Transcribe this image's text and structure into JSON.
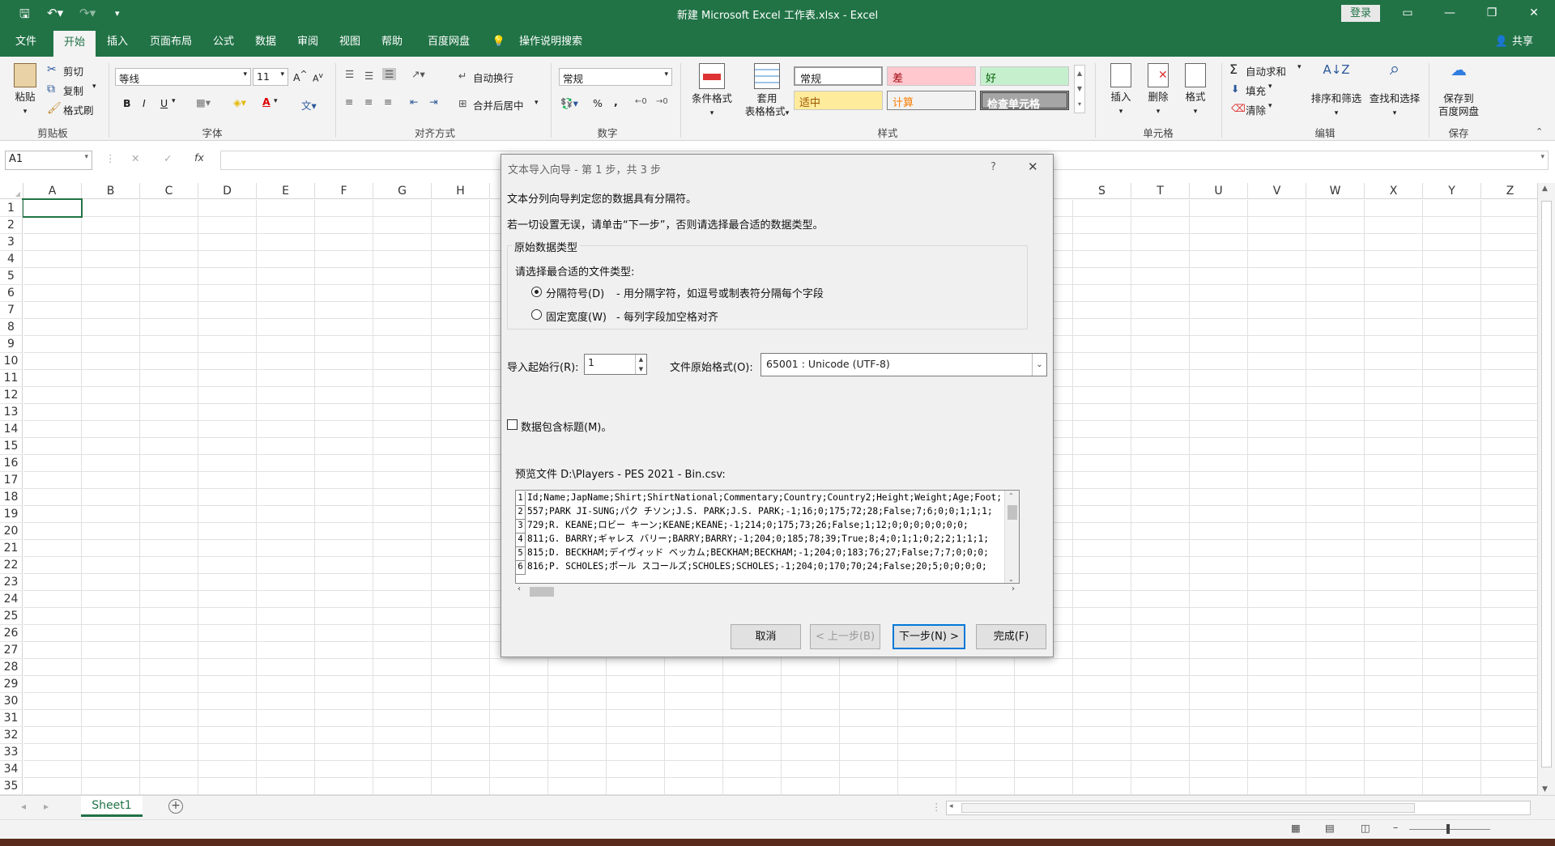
{
  "window": {
    "title": "新建 Microsoft Excel 工作表.xlsx  -  Excel",
    "login": "登录"
  },
  "tabs": [
    "文件",
    "开始",
    "插入",
    "页面布局",
    "公式",
    "数据",
    "审阅",
    "视图",
    "帮助",
    "百度网盘",
    "操作说明搜索"
  ],
  "share": "共享",
  "clipboard": {
    "paste": "粘贴",
    "cut": "剪切",
    "copy": "复制",
    "format_painter": "格式刷",
    "group": "剪贴板"
  },
  "font": {
    "name": "等线",
    "size": "11",
    "group": "字体",
    "bold": "B",
    "italic": "I",
    "underline": "U",
    "font_color_letter": "A"
  },
  "alignment": {
    "wrap": "自动换行",
    "merge": "合并后居中",
    "group": "对齐方式"
  },
  "number": {
    "format": "常规",
    "percent": "%",
    "comma": ",",
    "group": "数字"
  },
  "styles": {
    "cond": "条件格式",
    "table": "套用\n表格格式",
    "normal": "常规",
    "bad": "差",
    "good": "好",
    "neutral": "适中",
    "calc": "计算",
    "check": "检查单元格",
    "group": "样式"
  },
  "cells": {
    "insert": "插入",
    "delete": "删除",
    "format": "格式",
    "group": "单元格"
  },
  "editing": {
    "autosum": "自动求和",
    "fill": "填充",
    "clear": "清除",
    "sort": "排序和筛选",
    "find": "查找和选择",
    "group": "编辑"
  },
  "save": {
    "label": "保存到\n百度网盘",
    "group": "保存"
  },
  "formula_bar": {
    "namebox": "A1",
    "fx": "fx",
    "cancel": "✕",
    "enter": "✓"
  },
  "columns": [
    "A",
    "B",
    "C",
    "D",
    "E",
    "F",
    "G",
    "H",
    "S",
    "T",
    "U",
    "V",
    "W",
    "X",
    "Y",
    "Z"
  ],
  "rows": [
    "1",
    "2",
    "3",
    "4",
    "5",
    "6",
    "7",
    "8",
    "9",
    "10",
    "11",
    "12",
    "13",
    "14",
    "15",
    "16",
    "17",
    "18",
    "19",
    "20",
    "21",
    "22",
    "23",
    "24",
    "25",
    "26",
    "27",
    "28",
    "29",
    "30",
    "31",
    "32",
    "33",
    "34",
    "35"
  ],
  "sheet": {
    "tab": "Sheet1",
    "add": "+"
  },
  "dialog": {
    "title": "文本导入向导 - 第 1 步，共 3 步",
    "help": "?",
    "close": "✕",
    "line1": "文本分列向导判定您的数据具有分隔符。",
    "line2": "若一切设置无误，请单击“下一步”，否则请选择最合适的数据类型。",
    "group_label": "原始数据类型",
    "choose": "请选择最合适的文件类型:",
    "opt1": "分隔符号(D)",
    "opt1_desc": "- 用分隔字符，如逗号或制表符分隔每个字段",
    "opt2": "固定宽度(W)",
    "opt2_desc": "- 每列字段加空格对齐",
    "start_row_label": "导入起始行(R):",
    "start_row": "1",
    "origin_label": "文件原始格式(O):",
    "origin": "65001 : Unicode (UTF-8)",
    "headers_label": "数据包含标题(M)。",
    "preview_label": "预览文件 D:\\Players - PES 2021 - Bin.csv:",
    "preview": [
      {
        "n": "1",
        "t": "Id;Name;JapName;Shirt;ShirtNational;Commentary;Country;Country2;Height;Weight;Age;Foot;"
      },
      {
        "n": "2",
        "t": "557;PARK JI-SUNG;パク チソン;J.S. PARK;J.S. PARK;-1;16;0;175;72;28;False;7;6;0;0;1;1;1;"
      },
      {
        "n": "3",
        "t": "729;R. KEANE;ロビー キーン;KEANE;KEANE;-1;214;0;175;73;26;False;1;12;0;0;0;0;0;0;0;"
      },
      {
        "n": "4",
        "t": "811;G. BARRY;ギャレス バリー;BARRY;BARRY;-1;204;0;185;78;39;True;8;4;0;1;1;0;2;2;1;1;1;"
      },
      {
        "n": "5",
        "t": "815;D. BECKHAM;デイヴィッド ベッカム;BECKHAM;BECKHAM;-1;204;0;183;76;27;False;7;7;0;0;0;"
      },
      {
        "n": "6",
        "t": "816;P. SCHOLES;ポール スコールズ;SCHOLES;SCHOLES;-1;204;0;170;70;24;False;20;5;0;0;0;0;"
      }
    ],
    "btn_cancel": "取消",
    "btn_back": "< 上一步(B)",
    "btn_next": "下一步(N) >",
    "btn_finish": "完成(F)"
  },
  "colors": {
    "excel_green": "#217346",
    "dialog_bg": "#f0f0f0",
    "style_bad": "#ffc7ce",
    "style_good": "#c6efce",
    "style_neutral": "#ffeb9c"
  }
}
